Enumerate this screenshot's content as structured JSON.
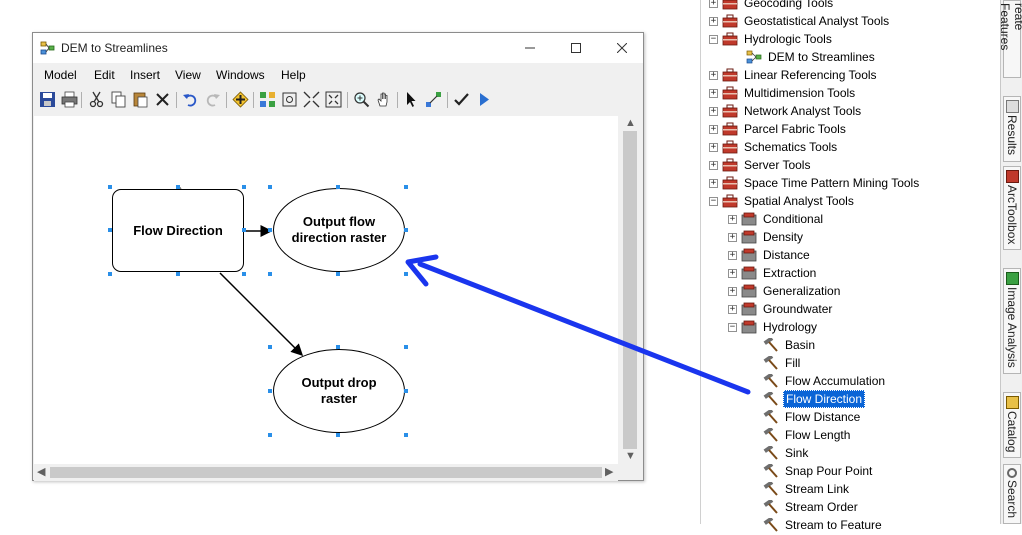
{
  "window": {
    "title": "DEM to Streamlines",
    "menu": [
      "Model",
      "Edit",
      "Insert",
      "View",
      "Windows",
      "Help"
    ]
  },
  "model": {
    "process_label": "Flow Direction",
    "output1_label": "Output flow direction raster",
    "output2_label": "Output drop raster"
  },
  "tree": {
    "items": [
      {
        "label": "Geocoding Tools",
        "expanded": false
      },
      {
        "label": "Geostatistical Analyst Tools",
        "expanded": false
      },
      {
        "label": "Hydrologic Tools",
        "expanded": true
      },
      {
        "label": "DEM to Streamlines",
        "type": "model"
      },
      {
        "label": "Linear Referencing Tools",
        "expanded": false
      },
      {
        "label": "Multidimension Tools",
        "expanded": false
      },
      {
        "label": "Network Analyst Tools",
        "expanded": false
      },
      {
        "label": "Parcel Fabric Tools",
        "expanded": false
      },
      {
        "label": "Schematics Tools",
        "expanded": false
      },
      {
        "label": "Server Tools",
        "expanded": false
      },
      {
        "label": "Space Time Pattern Mining Tools",
        "expanded": false
      },
      {
        "label": "Spatial Analyst Tools",
        "expanded": true
      }
    ],
    "spatial_children": [
      {
        "label": "Conditional",
        "expanded": false
      },
      {
        "label": "Density",
        "expanded": false
      },
      {
        "label": "Distance",
        "expanded": false
      },
      {
        "label": "Extraction",
        "expanded": false
      },
      {
        "label": "Generalization",
        "expanded": false
      },
      {
        "label": "Groundwater",
        "expanded": false
      },
      {
        "label": "Hydrology",
        "expanded": true
      }
    ],
    "hydrology_tools": [
      "Basin",
      "Fill",
      "Flow Accumulation",
      "Flow Direction",
      "Flow Distance",
      "Flow Length",
      "Sink",
      "Snap Pour Point",
      "Stream Link",
      "Stream Order",
      "Stream to Feature"
    ],
    "selected": "Flow Direction"
  },
  "dock": {
    "tabs": [
      "reate Features",
      "Results",
      "ArcToolbox",
      "Image Analysis",
      "Catalog",
      "Search"
    ]
  },
  "colors": {
    "selection": "#0a64d6",
    "annotation_arrow": "#1a35ee",
    "handle": "#2a8fe8",
    "toolbox_red": "#c0392b"
  }
}
